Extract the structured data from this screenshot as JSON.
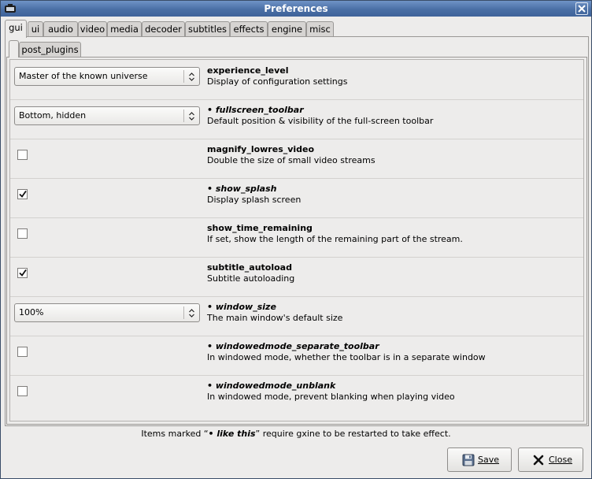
{
  "window": {
    "title": "Preferences"
  },
  "tabs": [
    {
      "label": "gui",
      "active": true
    },
    {
      "label": "ui"
    },
    {
      "label": "audio"
    },
    {
      "label": "video"
    },
    {
      "label": "media"
    },
    {
      "label": "decoder"
    },
    {
      "label": "subtitles"
    },
    {
      "label": "effects"
    },
    {
      "label": "engine"
    },
    {
      "label": "misc"
    }
  ],
  "subtabs": [
    {
      "label": "post_plugins"
    }
  ],
  "settings": [
    {
      "control": "combo",
      "value": "Master of the known universe",
      "name": "experience_level",
      "restart": false,
      "description": "Display of configuration settings"
    },
    {
      "control": "combo",
      "value": "Bottom, hidden",
      "name": "• fullscreen_toolbar",
      "restart": true,
      "description": "Default position & visibility of the full-screen toolbar"
    },
    {
      "control": "checkbox",
      "checked": false,
      "name": "magnify_lowres_video",
      "restart": false,
      "description": "Double the size of small video streams"
    },
    {
      "control": "checkbox",
      "checked": true,
      "name": "• show_splash",
      "restart": true,
      "description": "Display splash screen"
    },
    {
      "control": "checkbox",
      "checked": false,
      "name": "show_time_remaining",
      "restart": false,
      "description": "If set, show the length of the remaining part of the stream."
    },
    {
      "control": "checkbox",
      "checked": true,
      "name": "subtitle_autoload",
      "restart": false,
      "description": "Subtitle autoloading"
    },
    {
      "control": "combo",
      "value": "100%",
      "name": "• window_size",
      "restart": true,
      "description": "The main window's default size"
    },
    {
      "control": "checkbox",
      "checked": false,
      "name": "• windowedmode_separate_toolbar",
      "restart": true,
      "description": "In windowed mode, whether the toolbar is in a separate window"
    },
    {
      "control": "checkbox",
      "checked": false,
      "name": "• windowedmode_unblank",
      "restart": true,
      "description": "In windowed mode, prevent blanking when playing video"
    }
  ],
  "footnote": {
    "prefix": "Items marked “",
    "marker": "• like this",
    "suffix": "” require gxine to be restarted to take effect."
  },
  "buttons": {
    "save": "Save",
    "close": "Close"
  },
  "colors": {
    "titlebar": "#4a6fa5",
    "window_bg": "#edeceb"
  }
}
